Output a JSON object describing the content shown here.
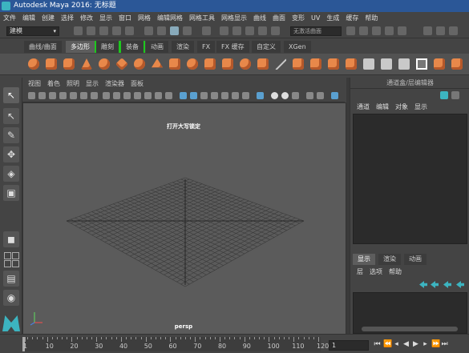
{
  "window": {
    "title": "Autodesk Maya 2016: 无标题"
  },
  "menubar": [
    "文件",
    "编辑",
    "创建",
    "选择",
    "修改",
    "显示",
    "窗口",
    "网格",
    "编辑网格",
    "网格工具",
    "网格显示",
    "曲线",
    "曲面",
    "变形",
    "UV",
    "生成",
    "缓存",
    "帮助"
  ],
  "statusline": {
    "mode": "建模",
    "no_selection": "无激活曲面"
  },
  "shelf": {
    "tabs": [
      "曲线/曲面",
      "多边形",
      "雕刻",
      "装备",
      "动画",
      "渲染",
      "FX",
      "FX 缓存",
      "自定义",
      "XGen"
    ],
    "active_tab": "多边形"
  },
  "viewport": {
    "menu": [
      "视图",
      "着色",
      "照明",
      "显示",
      "渲染器",
      "面板"
    ],
    "hint": "打开大写锁定",
    "camera": "persp"
  },
  "channel_box": {
    "title": "通道盒/层编辑器",
    "menu": [
      "通道",
      "编辑",
      "对象",
      "显示"
    ]
  },
  "layer_editor": {
    "tabs": [
      "显示",
      "渲染",
      "动画"
    ],
    "active_tab": "显示",
    "menu": [
      "层",
      "选项",
      "帮助"
    ]
  },
  "timeslider": {
    "ticks": [
      "1",
      "10",
      "20",
      "30",
      "40",
      "50",
      "60",
      "70",
      "80",
      "90",
      "100",
      "110",
      "120"
    ],
    "current_frame": "1"
  },
  "icons": {
    "toolbox": [
      "select-icon",
      "lasso-icon",
      "paint-select-icon",
      "move-icon",
      "rotate-icon",
      "scale-icon"
    ],
    "playback": [
      "go-start-icon",
      "step-back-key-icon",
      "step-back-icon",
      "play-back-icon",
      "play-forward-icon",
      "step-forward-icon",
      "step-forward-key-icon",
      "go-end-icon"
    ]
  },
  "colors": {
    "titlebar": "#2b5797",
    "maya_logo": "#3cb4c0",
    "shelf_poly": "#e8884a",
    "viewport_bg": "#5b5b5b"
  }
}
